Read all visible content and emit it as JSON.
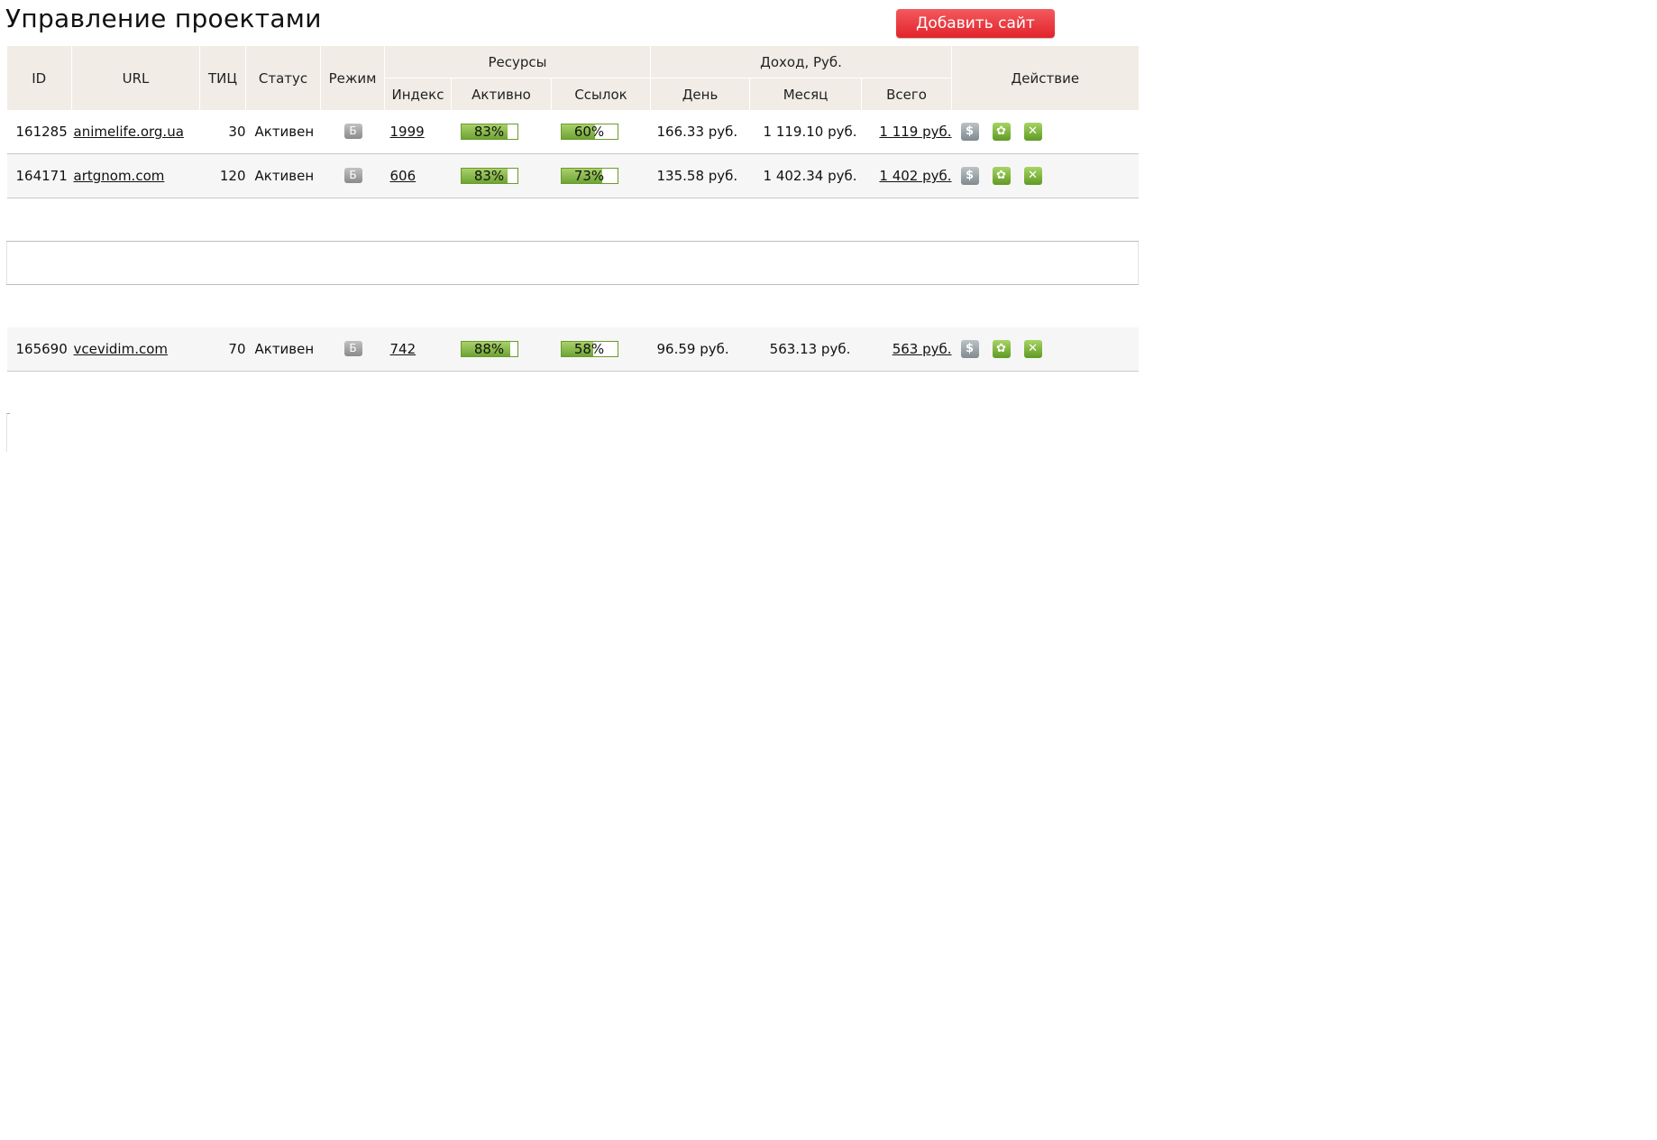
{
  "page": {
    "title": "Управление проектами",
    "add_site_label": "Добавить сайт"
  },
  "table": {
    "headers": {
      "id": "ID",
      "url": "URL",
      "tic": "ТИЦ",
      "status": "Статус",
      "mode": "Режим",
      "resources_group": "Ресурсы",
      "index": "Индекс",
      "active": "Активно",
      "links": "Ссылок",
      "income_group": "Доход, Руб.",
      "day": "День",
      "month": "Месяц",
      "total": "Всего",
      "action": "Действие"
    },
    "rows": [
      {
        "id": "161285",
        "url": "animelife.org.ua",
        "tic": "30",
        "status": "Активен",
        "mode_icon": "Б",
        "index": "1999",
        "active_pct": "83%",
        "active_fill": 83,
        "links_pct": "60%",
        "links_fill": 60,
        "day": "166.33 руб.",
        "month": "1 119.10 руб.",
        "total": "1 119 руб."
      },
      {
        "id": "164171",
        "url": "artgnom.com",
        "tic": "120",
        "status": "Активен",
        "mode_icon": "Б",
        "index": "606",
        "active_pct": "83%",
        "active_fill": 83,
        "links_pct": "73%",
        "links_fill": 73,
        "day": "135.58 руб.",
        "month": "1 402.34 руб.",
        "total": "1 402 руб."
      },
      {
        "id": "165690",
        "url": "vcevidim.com",
        "tic": "70",
        "status": "Активен",
        "mode_icon": "Б",
        "index": "742",
        "active_pct": "88%",
        "active_fill": 88,
        "links_pct": "58%",
        "links_fill": 58,
        "day": "96.59 руб.",
        "month": "563.13 руб.",
        "total": "563 руб."
      }
    ]
  },
  "icons": {
    "mode": "mode-badge-icon",
    "money": "dollar-icon",
    "settings": "gear-icon",
    "delete": "close-icon"
  },
  "colors": {
    "add_button": "#e2232a",
    "header_bg": "#f1ede6",
    "progress_fill": "#6ea534"
  }
}
